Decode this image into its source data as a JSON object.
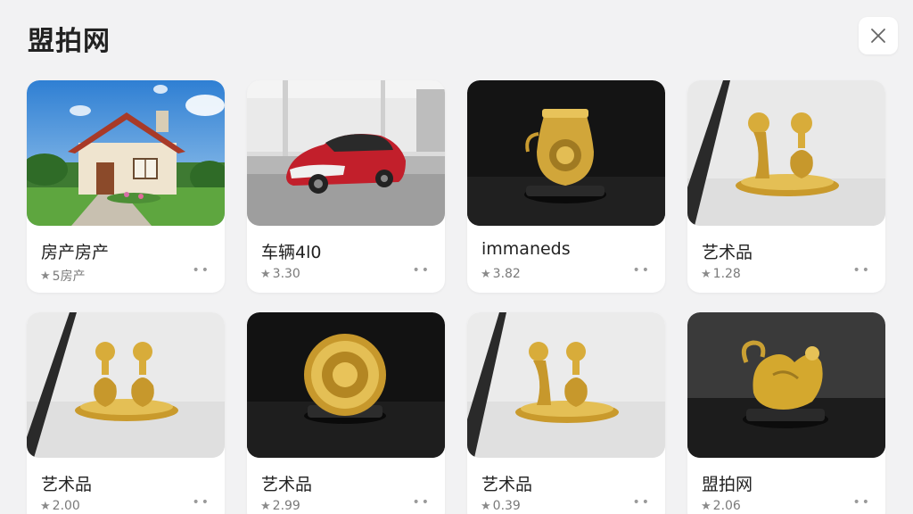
{
  "header": {
    "title": "盟拍网"
  },
  "cards": [
    {
      "title": "房产房产",
      "rating": "5房产",
      "thumb": "house"
    },
    {
      "title": "车辆4l0",
      "rating": "3.30",
      "thumb": "car"
    },
    {
      "title": "immaneds",
      "rating": "3.82",
      "thumb": "vase"
    },
    {
      "title": "艺术品",
      "rating": "1.28",
      "thumb": "figures-tray"
    },
    {
      "title": "艺术品",
      "rating": "2.00",
      "thumb": "figures-tray"
    },
    {
      "title": "艺术品",
      "rating": "2.99",
      "thumb": "plate"
    },
    {
      "title": "艺术品",
      "rating": "0.39",
      "thumb": "figures-tray"
    },
    {
      "title": "盟拍网",
      "rating": "2.06",
      "thumb": "swan"
    }
  ],
  "icons": {
    "close": "close-icon",
    "rating": "star-icon",
    "more": "more-icon"
  },
  "colors": {
    "background": "#f2f2f3",
    "card": "#ffffff",
    "gold": "#d4a82e"
  }
}
